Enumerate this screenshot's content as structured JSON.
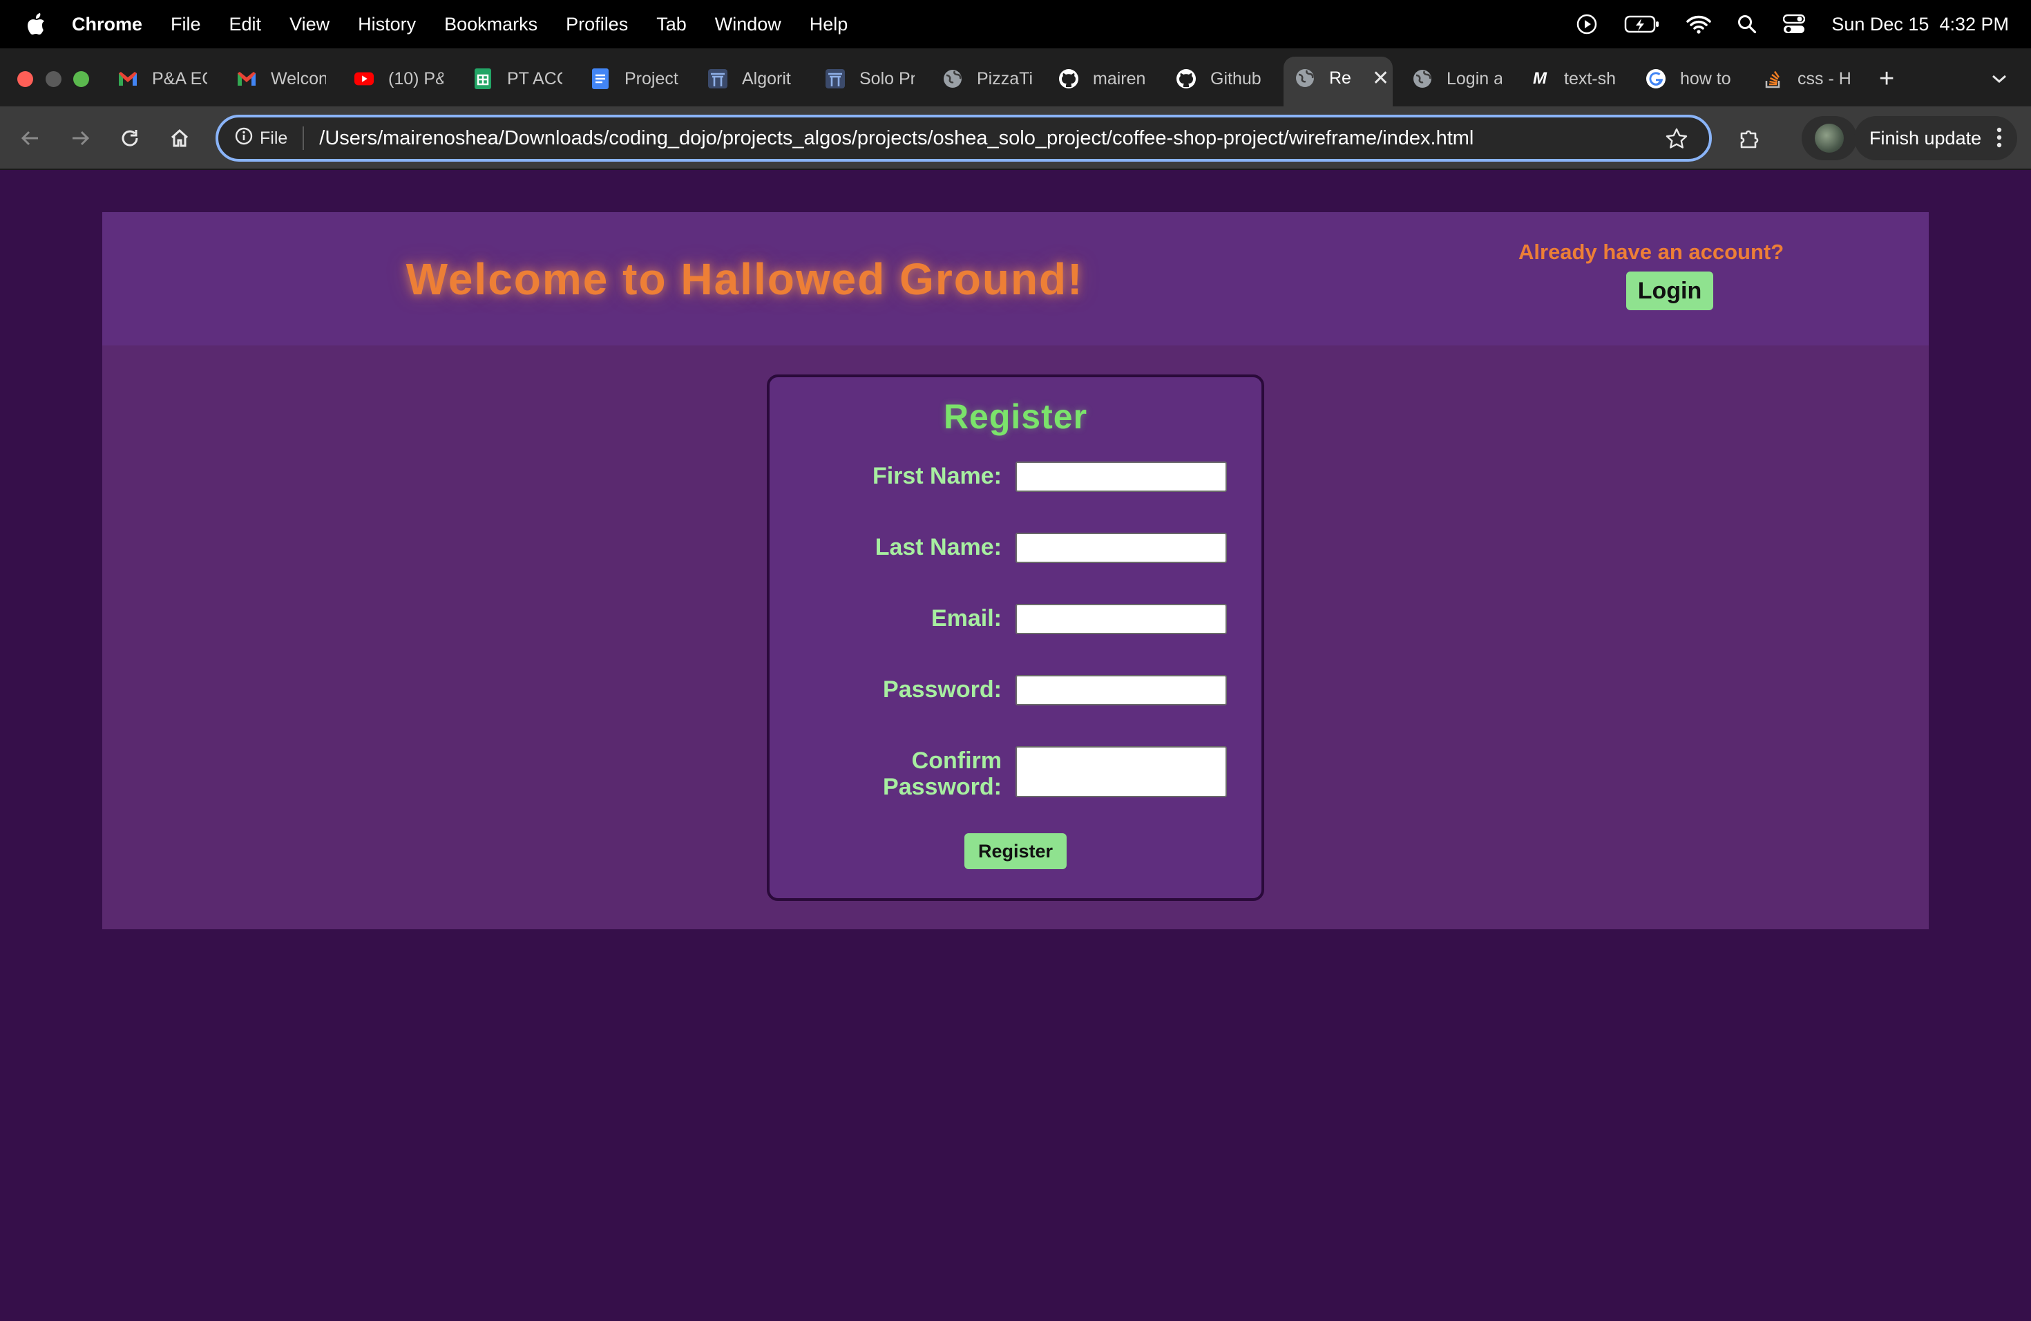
{
  "menubar": {
    "app": "Chrome",
    "items": [
      "File",
      "Edit",
      "View",
      "History",
      "Bookmarks",
      "Profiles",
      "Tab",
      "Window",
      "Help"
    ],
    "datetime": "Sun Dec 15  4:32 PM"
  },
  "tabs": [
    {
      "label": "P&A EC",
      "icon": "gmail-icon"
    },
    {
      "label": "Welcon",
      "icon": "gmail-icon"
    },
    {
      "label": "(10) P&",
      "icon": "youtube-icon"
    },
    {
      "label": "PT ACC",
      "icon": "sheets-icon"
    },
    {
      "label": "Project",
      "icon": "docs-icon"
    },
    {
      "label": "Algorit",
      "icon": "gate-icon"
    },
    {
      "label": "Solo Pr",
      "icon": "gate-icon"
    },
    {
      "label": "PizzaTi",
      "icon": "globe-icon"
    },
    {
      "label": "mairen",
      "icon": "github-icon"
    },
    {
      "label": "Github",
      "icon": "github-icon"
    },
    {
      "label": "Re",
      "icon": "globe-icon",
      "active": true
    },
    {
      "label": "Login a",
      "icon": "globe-icon"
    },
    {
      "label": "text-sh",
      "icon": "medium-icon"
    },
    {
      "label": "how to",
      "icon": "google-icon"
    },
    {
      "label": "css - H",
      "icon": "stackoverflow-icon"
    }
  ],
  "toolbar": {
    "scheme_label": "File",
    "url": "/Users/mairenoshea/Downloads/coding_dojo/projects_algos/projects/oshea_solo_project/coffee-shop-project/wireframe/index.html",
    "update_label": "Finish update"
  },
  "page": {
    "title": "Welcome to Hallowed Ground!",
    "account_prompt": "Already have an account?",
    "login_label": "Login",
    "form": {
      "title": "Register",
      "fields": [
        {
          "label": "First Name:",
          "value": ""
        },
        {
          "label": "Last Name:",
          "value": ""
        },
        {
          "label": "Email:",
          "value": ""
        },
        {
          "label": "Password:",
          "value": ""
        },
        {
          "label_line1": "Confirm",
          "label_line2": "Password:",
          "value": ""
        }
      ],
      "submit_label": "Register"
    }
  },
  "colors": {
    "page_bg": "#360f4a",
    "container_bg": "#5a296f",
    "header_bg": "#5f2e7e",
    "title_orange": "#ed7f36",
    "form_green": "#7be36b",
    "button_green": "#8fe28f"
  }
}
